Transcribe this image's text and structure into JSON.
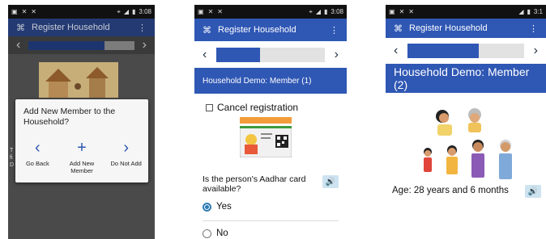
{
  "screen1": {
    "status_time": "3:08",
    "app_title": "Register Household",
    "dialog_title": "Add New Member to the Household?",
    "buttons": [
      {
        "icon": "chevron-left-icon",
        "glyph": "‹",
        "label": "Go Back"
      },
      {
        "icon": "plus-icon",
        "glyph": "+",
        "label": "Add New Member"
      },
      {
        "icon": "chevron-right-icon",
        "glyph": "›",
        "label": "Do Not Add"
      }
    ],
    "edge_letters": [
      "T",
      "fi",
      "D"
    ],
    "progress": 0.72
  },
  "screen2": {
    "status_time": "3:08",
    "app_title": "Register Household",
    "section_title": "Household Demo: Member (1)",
    "cancel_label": "Cancel registration",
    "question": "Is the person's Aadhar card available?",
    "options": [
      "Yes",
      "No"
    ],
    "selected": "Yes",
    "progress": 0.4
  },
  "screen3": {
    "status_time": "3:1",
    "app_title": "Register Household",
    "section_title": "Household Demo: Member (2)",
    "age_text": "Age: 28 years and 6 months",
    "progress": 0.61
  },
  "colors": {
    "primary": "#2f57b4",
    "progress_track": "#e2e2e2",
    "radio_selected": "#2a7ab5",
    "speaker_bg": "#cde3f0"
  }
}
